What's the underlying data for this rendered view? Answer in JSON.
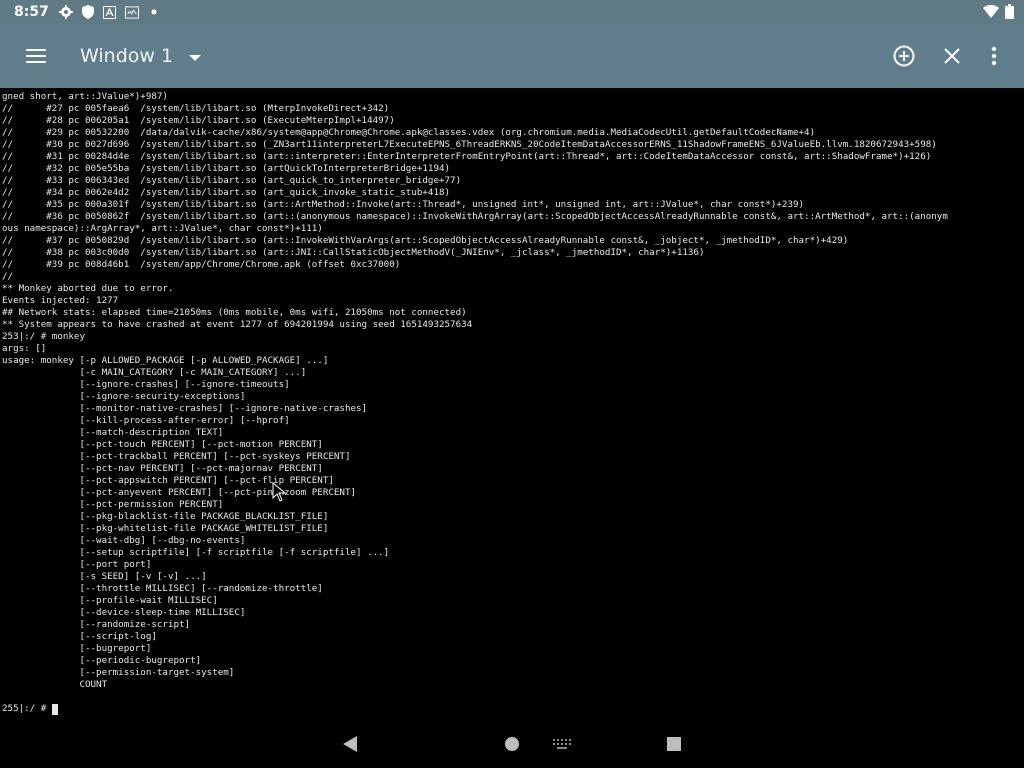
{
  "status_bar": {
    "time": "8:57",
    "icons": [
      "gear-icon",
      "shield-icon",
      "a-box-icon",
      "monitor-icon",
      "dot-icon"
    ],
    "right_icons": [
      "wifi-icon",
      "battery-icon"
    ]
  },
  "toolbar": {
    "title": "Window 1",
    "bg_color": "#607d8b"
  },
  "terminal": {
    "lines": [
      "gned short, art::JValue*)+987)",
      "//      #27 pc 005faea6  /system/lib/libart.so (MterpInvokeDirect+342)",
      "//      #28 pc 006205a1  /system/lib/libart.so (ExecuteMterpImpl+14497)",
      "//      #29 pc 00532200  /data/dalvik-cache/x86/system@app@Chrome@Chrome.apk@classes.vdex (org.chromium.media.MediaCodecUtil.getDefaultCodecName+4)",
      "//      #30 pc 0027d696  /system/lib/libart.so (_ZN3art11interpreterL7ExecuteEPNS_6ThreadERKNS_20CodeItemDataAccessorERNS_11ShadowFrameENS_6JValueEb.llvm.1820672943+598)",
      "//      #31 pc 00284d4e  /system/lib/libart.so (art::interpreter::EnterInterpreterFromEntryPoint(art::Thread*, art::CodeItemDataAccessor const&, art::ShadowFrame*)+126)",
      "//      #32 pc 005e55ba  /system/lib/libart.so (artQuickToInterpreterBridge+1194)",
      "//      #33 pc 006343ed  /system/lib/libart.so (art_quick_to_interpreter_bridge+77)",
      "//      #34 pc 0062e4d2  /system/lib/libart.so (art_quick_invoke_static_stub+418)",
      "//      #35 pc 000a301f  /system/lib/libart.so (art::ArtMethod::Invoke(art::Thread*, unsigned int*, unsigned int, art::JValue*, char const*)+239)",
      "//      #36 pc 0050862f  /system/lib/libart.so (art::(anonymous namespace)::InvokeWithArgArray(art::ScopedObjectAccessAlreadyRunnable const&, art::ArtMethod*, art::(anonym",
      "ous namespace)::ArgArray*, art::JValue*, char const*)+111)",
      "//      #37 pc 0050829d  /system/lib/libart.so (art::InvokeWithVarArgs(art::ScopedObjectAccessAlreadyRunnable const&, _jobject*, _jmethodID*, char*)+429)",
      "//      #38 pc 003c00d0  /system/lib/libart.so (art::JNI::CallStaticObjectMethodV(_JNIEnv*, _jclass*, _jmethodID*, char*)+1136)",
      "//      #39 pc 008d46b1  /system/app/Chrome/Chrome.apk (offset 0xc37000)",
      "//",
      "** Monkey aborted due to error.",
      "Events injected: 1277",
      "## Network stats: elapsed time=21050ms (0ms mobile, 0ms wifi, 21050ms not connected)",
      "** System appears to have crashed at event 1277 of 694201994 using seed 1651493257634",
      "253|:/ # monkey",
      "args: []",
      "usage: monkey [-p ALLOWED_PACKAGE [-p ALLOWED_PACKAGE] ...]",
      "              [-c MAIN_CATEGORY [-c MAIN_CATEGORY] ...]",
      "              [--ignore-crashes] [--ignore-timeouts]",
      "              [--ignore-security-exceptions]",
      "              [--monitor-native-crashes] [--ignore-native-crashes]",
      "              [--kill-process-after-error] [--hprof]",
      "              [--match-description TEXT]",
      "              [--pct-touch PERCENT] [--pct-motion PERCENT]",
      "              [--pct-trackball PERCENT] [--pct-syskeys PERCENT]",
      "              [--pct-nav PERCENT] [--pct-majornav PERCENT]",
      "              [--pct-appswitch PERCENT] [--pct-flip PERCENT]",
      "              [--pct-anyevent PERCENT] [--pct-pinchzoom PERCENT]",
      "              [--pct-permission PERCENT]",
      "              [--pkg-blacklist-file PACKAGE_BLACKLIST_FILE]",
      "              [--pkg-whitelist-file PACKAGE_WHITELIST_FILE]",
      "              [--wait-dbg] [--dbg-no-events]",
      "              [--setup scriptfile] [-f scriptfile [-f scriptfile] ...]",
      "              [--port port]",
      "              [-s SEED] [-v [-v] ...]",
      "              [--throttle MILLISEC] [--randomize-throttle]",
      "              [--profile-wait MILLISEC]",
      "              [--device-sleep-time MILLISEC]",
      "              [--randomize-script]",
      "              [--script-log]",
      "              [--bugreport]",
      "              [--periodic-bugreport]",
      "              [--permission-target-system]",
      "              COUNT",
      "",
      "255|:/ # "
    ],
    "text_color": "#e8e8e8",
    "bg_color": "#000000"
  },
  "nav_bar": {
    "buttons": [
      "back-icon",
      "home-icon",
      "keyboard-icon",
      "recents-icon"
    ]
  }
}
